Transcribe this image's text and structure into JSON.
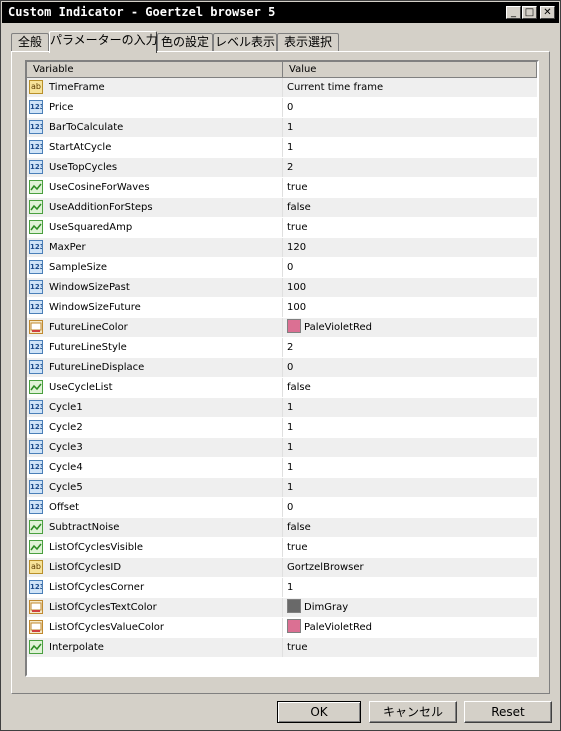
{
  "window": {
    "title": "Custom Indicator - Goertzel browser 5"
  },
  "tabs": [
    {
      "label": "全般"
    },
    {
      "label": "パラメーターの入力"
    },
    {
      "label": "色の設定"
    },
    {
      "label": "レベル表示"
    },
    {
      "label": "表示選択"
    }
  ],
  "grid": {
    "col_variable": "Variable",
    "col_value": "Value",
    "rows": [
      {
        "type": "str",
        "icon": "ab",
        "name": "TimeFrame",
        "value": "Current time frame"
      },
      {
        "type": "num",
        "icon": "123",
        "name": "Price",
        "value": "0"
      },
      {
        "type": "num",
        "icon": "123",
        "name": "BarToCalculate",
        "value": "1"
      },
      {
        "type": "num",
        "icon": "123",
        "name": "StartAtCycle",
        "value": "1"
      },
      {
        "type": "num",
        "icon": "123",
        "name": "UseTopCycles",
        "value": "2"
      },
      {
        "type": "bool",
        "icon": "",
        "name": "UseCosineForWaves",
        "value": "true"
      },
      {
        "type": "bool",
        "icon": "",
        "name": "UseAdditionForSteps",
        "value": "false"
      },
      {
        "type": "bool",
        "icon": "",
        "name": "UseSquaredAmp",
        "value": "true"
      },
      {
        "type": "num",
        "icon": "123",
        "name": "MaxPer",
        "value": "120"
      },
      {
        "type": "num",
        "icon": "123",
        "name": "SampleSize",
        "value": "0"
      },
      {
        "type": "num",
        "icon": "123",
        "name": "WindowSizePast",
        "value": "100"
      },
      {
        "type": "num",
        "icon": "123",
        "name": "WindowSizeFuture",
        "value": "100"
      },
      {
        "type": "col",
        "icon": "",
        "name": "FutureLineColor",
        "value": "PaleVioletRed",
        "swatch": "#db7093"
      },
      {
        "type": "num",
        "icon": "123",
        "name": "FutureLineStyle",
        "value": "2"
      },
      {
        "type": "num",
        "icon": "123",
        "name": "FutureLineDisplace",
        "value": "0"
      },
      {
        "type": "bool",
        "icon": "",
        "name": "UseCycleList",
        "value": "false"
      },
      {
        "type": "num",
        "icon": "123",
        "name": "Cycle1",
        "value": "1"
      },
      {
        "type": "num",
        "icon": "123",
        "name": "Cycle2",
        "value": "1"
      },
      {
        "type": "num",
        "icon": "123",
        "name": "Cycle3",
        "value": "1"
      },
      {
        "type": "num",
        "icon": "123",
        "name": "Cycle4",
        "value": "1"
      },
      {
        "type": "num",
        "icon": "123",
        "name": "Cycle5",
        "value": "1"
      },
      {
        "type": "num",
        "icon": "123",
        "name": "Offset",
        "value": "0"
      },
      {
        "type": "bool",
        "icon": "",
        "name": "SubtractNoise",
        "value": "false"
      },
      {
        "type": "bool",
        "icon": "",
        "name": "ListOfCyclesVisible",
        "value": "true"
      },
      {
        "type": "str",
        "icon": "ab",
        "name": "ListOfCyclesID",
        "value": "GortzelBrowser"
      },
      {
        "type": "num",
        "icon": "123",
        "name": "ListOfCyclesCorner",
        "value": "1"
      },
      {
        "type": "col",
        "icon": "",
        "name": "ListOfCyclesTextColor",
        "value": "DimGray",
        "swatch": "#696969"
      },
      {
        "type": "col",
        "icon": "",
        "name": "ListOfCyclesValueColor",
        "value": "PaleVioletRed",
        "swatch": "#db7093"
      },
      {
        "type": "bool",
        "icon": "",
        "name": "Interpolate",
        "value": "true"
      }
    ]
  },
  "buttons": {
    "ok": "OK",
    "cancel": "キャンセル",
    "reset": "Reset"
  }
}
